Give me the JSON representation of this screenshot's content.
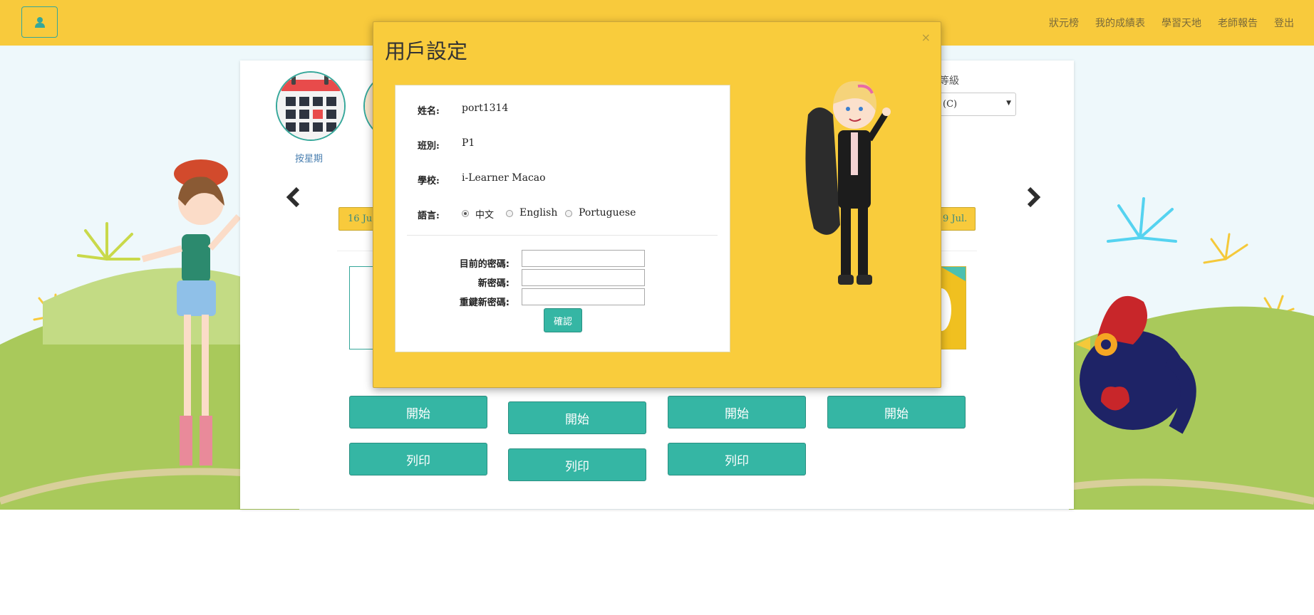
{
  "header": {
    "user_icon": "user-icon",
    "nav": [
      "狀元榜",
      "我的成績表",
      "學習天地",
      "老師報告",
      "登出"
    ]
  },
  "panel": {
    "week_label": "按星期",
    "grade_label": "等級",
    "grade_value": "(C)",
    "date_left": "16 Ju",
    "date_right": "9 Jul.",
    "prev_icon": "chevron-left-icon",
    "next_icon": "chevron-right-icon",
    "start_label": "開始",
    "print_label": "列印"
  },
  "modal": {
    "title": "用戶設定",
    "close": "×",
    "name_label": "姓名:",
    "name_value": "port1314",
    "class_label": "班別:",
    "class_value": "P1",
    "school_label": "學校:",
    "school_value": "i-Learner Macao",
    "language_label": "語言:",
    "languages": [
      "中文",
      "English",
      "Portuguese"
    ],
    "selected_language": "中文",
    "current_pw_label": "目前的密碼:",
    "new_pw_label": "新密碼:",
    "repeat_pw_label": "重鍵新密碼:",
    "confirm_label": "確認"
  },
  "colors": {
    "accent_yellow": "#f8ca3c",
    "accent_teal": "#35b6a4"
  }
}
